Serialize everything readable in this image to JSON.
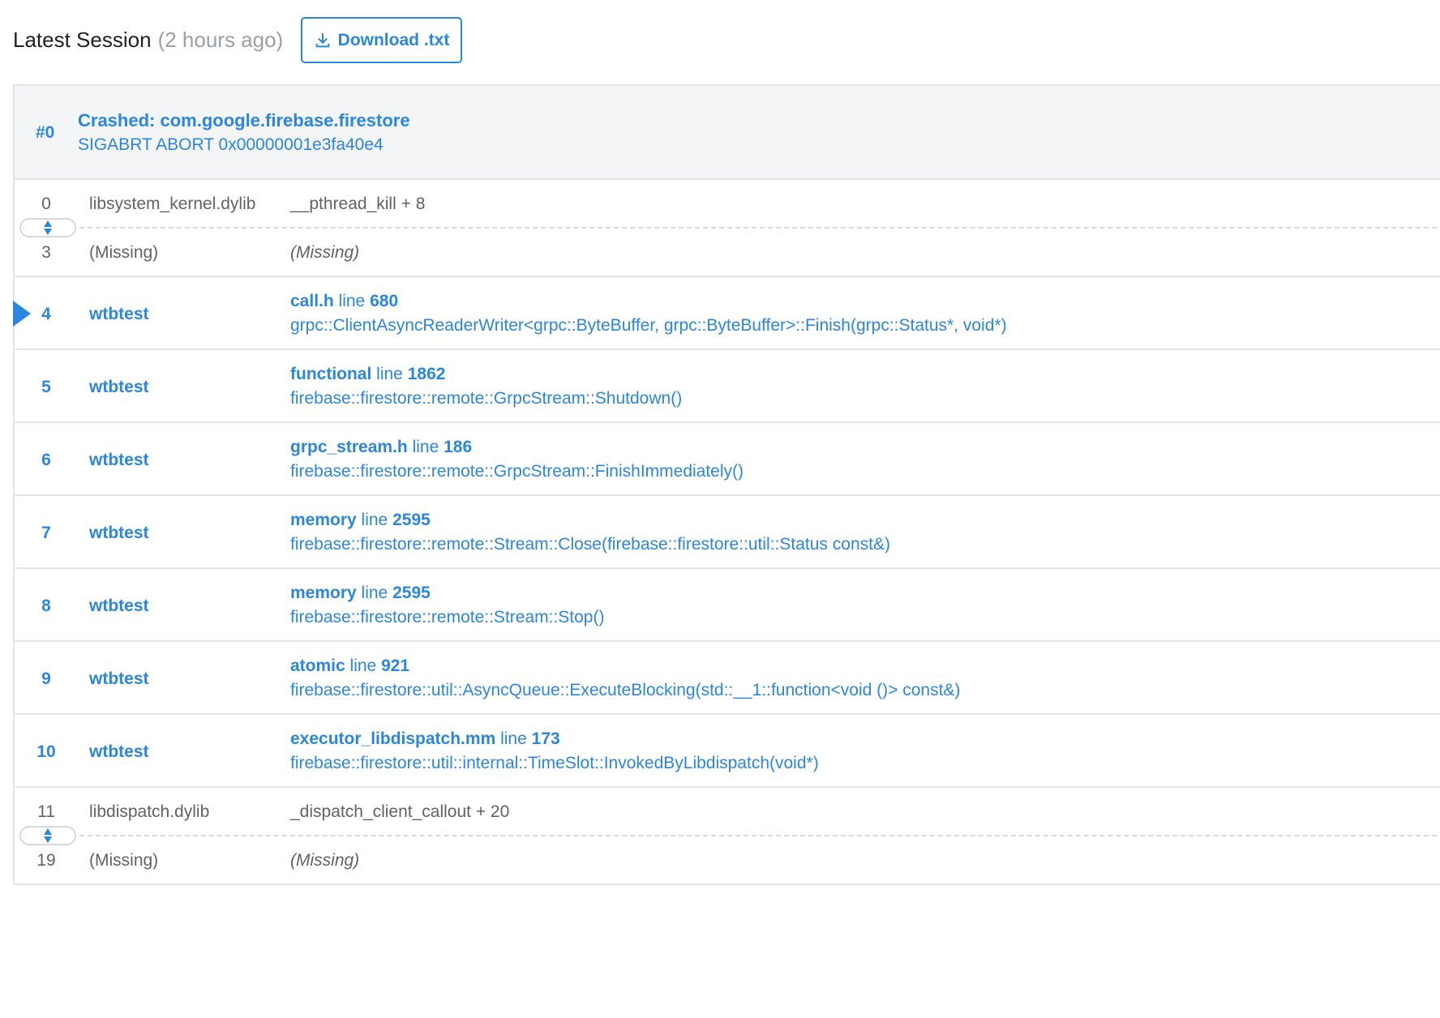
{
  "header": {
    "title": "Latest Session",
    "ago": "(2 hours ago)",
    "download_label": "Download .txt"
  },
  "thread": {
    "number": "#0",
    "title": "Crashed: com.google.firebase.firestore",
    "signal": "SIGABRT ABORT 0x00000001e3fa40e4"
  },
  "frames": {
    "f0": {
      "num": "0",
      "lib": "libsystem_kernel.dylib",
      "fn": "__pthread_kill + 8"
    },
    "f3": {
      "num": "3",
      "lib": "(Missing)",
      "fn": "(Missing)"
    },
    "f4": {
      "num": "4",
      "lib": "wtbtest",
      "file": "call.h",
      "line_word": "line",
      "line": "680",
      "symbol": "grpc::ClientAsyncReaderWriter<grpc::ByteBuffer, grpc::ByteBuffer>::Finish(grpc::Status*, void*)"
    },
    "f5": {
      "num": "5",
      "lib": "wtbtest",
      "file": "functional",
      "line_word": "line",
      "line": "1862",
      "symbol": "firebase::firestore::remote::GrpcStream::Shutdown()"
    },
    "f6": {
      "num": "6",
      "lib": "wtbtest",
      "file": "grpc_stream.h",
      "line_word": "line",
      "line": "186",
      "symbol": "firebase::firestore::remote::GrpcStream::FinishImmediately()"
    },
    "f7": {
      "num": "7",
      "lib": "wtbtest",
      "file": "memory",
      "line_word": "line",
      "line": "2595",
      "symbol": "firebase::firestore::remote::Stream::Close(firebase::firestore::util::Status const&)"
    },
    "f8": {
      "num": "8",
      "lib": "wtbtest",
      "file": "memory",
      "line_word": "line",
      "line": "2595",
      "symbol": "firebase::firestore::remote::Stream::Stop()"
    },
    "f9": {
      "num": "9",
      "lib": "wtbtest",
      "file": "atomic",
      "line_word": "line",
      "line": "921",
      "symbol": "firebase::firestore::util::AsyncQueue::ExecuteBlocking(std::__1::function<void ()> const&)"
    },
    "f10": {
      "num": "10",
      "lib": "wtbtest",
      "file": "executor_libdispatch.mm",
      "line_word": "line",
      "line": "173",
      "symbol": "firebase::firestore::util::internal::TimeSlot::InvokedByLibdispatch(void*)"
    },
    "f11": {
      "num": "11",
      "lib": "libdispatch.dylib",
      "fn": "_dispatch_client_callout + 20"
    },
    "f19": {
      "num": "19",
      "lib": "(Missing)",
      "fn": "(Missing)"
    }
  },
  "icons": {
    "download": "download-icon",
    "expand": "expand-icon",
    "marker": "current-frame-marker"
  },
  "colors": {
    "accent": "#2b86e2",
    "muted": "#5f6368",
    "header_bg": "#f4f5f6",
    "border": "#e2e5e8"
  }
}
